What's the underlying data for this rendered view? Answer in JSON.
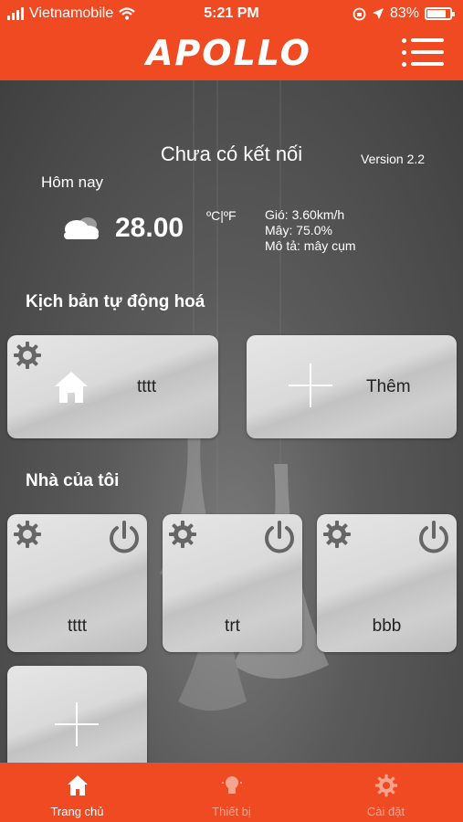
{
  "status_bar": {
    "carrier": "Vietnamobile",
    "time": "5:21 PM",
    "battery": "83%"
  },
  "header": {
    "logo": "APOLLO"
  },
  "connection": {
    "status": "Chưa có kết nối",
    "version": "Version 2.2"
  },
  "weather": {
    "today_label": "Hôm nay",
    "temperature": "28.00",
    "unit_toggle": "ºC|ºF",
    "wind": "Gió: 3.60km/h",
    "cloud": "Mây: 75.0%",
    "description": "Mô tả: mây cụm"
  },
  "automation": {
    "title": "Kịch bản tự động hoá",
    "items": [
      {
        "label": "tttt",
        "icon": "home-icon"
      },
      {
        "label": "Thêm",
        "icon": "plus-icon"
      }
    ]
  },
  "my_home": {
    "title": "Nhà của tôi",
    "items": [
      {
        "label": "tttt"
      },
      {
        "label": "trt"
      },
      {
        "label": "bbb"
      }
    ]
  },
  "tabs": [
    {
      "label": "Trang chủ",
      "icon": "home-icon",
      "active": true
    },
    {
      "label": "Thiết bị",
      "icon": "bulb-icon",
      "active": false
    },
    {
      "label": "Cài đặt",
      "icon": "gear-icon",
      "active": false
    }
  ],
  "colors": {
    "brand": "#f04a23",
    "tab_inactive": "#f7a48f"
  }
}
